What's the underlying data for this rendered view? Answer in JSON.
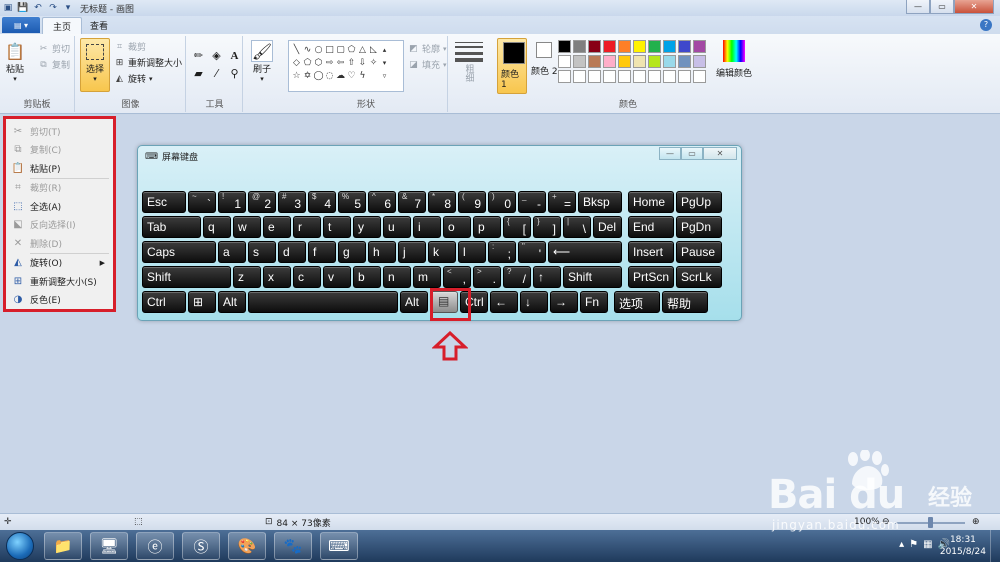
{
  "window": {
    "title": "无标题 - 画图"
  },
  "tabs": [
    {
      "label": "主页",
      "active": true
    },
    {
      "label": "查看",
      "active": false
    }
  ],
  "ribbon": {
    "clipboard": {
      "paste": "粘贴",
      "cut": "剪切",
      "copy": "复制",
      "group": "剪贴板"
    },
    "image": {
      "select": "选择",
      "crop": "裁剪",
      "resize": "重新调整大小",
      "rotate": "旋转",
      "group": "图像"
    },
    "tools": {
      "group": "工具"
    },
    "brushes": {
      "label": "刷子"
    },
    "shapes": {
      "outline": "轮廓",
      "fill": "填充",
      "group": "形状"
    },
    "size": {
      "label": "粗细"
    },
    "colors": {
      "color1": "颜色 1",
      "color2": "颜色 2",
      "edit": "编辑颜色",
      "group": "颜色",
      "palette": [
        "#000000",
        "#7f7f7f",
        "#880015",
        "#ed1c24",
        "#ff7f27",
        "#fff200",
        "#22b14c",
        "#00a2e8",
        "#3f48cc",
        "#a349a4",
        "#ffffff",
        "#c3c3c3",
        "#b97a57",
        "#ffaec9",
        "#ffc90e",
        "#efe4b0",
        "#b5e61d",
        "#99d9ea",
        "#7092be",
        "#c8bfe7",
        "#ffffff",
        "#ffffff",
        "#ffffff",
        "#ffffff",
        "#ffffff",
        "#ffffff",
        "#ffffff",
        "#ffffff",
        "#ffffff",
        "#ffffff"
      ]
    }
  },
  "context_menu": [
    {
      "label": "剪切(T)",
      "icon": "scissors-icon",
      "disabled": true
    },
    {
      "label": "复制(C)",
      "icon": "copy-icon",
      "disabled": true
    },
    {
      "label": "粘贴(P)",
      "icon": "paste-icon",
      "disabled": false
    },
    {
      "sep": true
    },
    {
      "label": "裁剪(R)",
      "icon": "crop-icon",
      "disabled": true
    },
    {
      "label": "全选(A)",
      "icon": "select-all-icon",
      "disabled": false
    },
    {
      "label": "反向选择(I)",
      "icon": "invert-selection-icon",
      "disabled": true
    },
    {
      "label": "删除(D)",
      "icon": "delete-icon",
      "disabled": true
    },
    {
      "sep": true
    },
    {
      "label": "旋转(O)",
      "icon": "rotate-icon",
      "disabled": false,
      "submenu": true
    },
    {
      "label": "重新调整大小(S)",
      "icon": "resize-icon",
      "disabled": false
    },
    {
      "label": "反色(E)",
      "icon": "invert-color-icon",
      "disabled": false
    }
  ],
  "osk": {
    "title": "屏幕键盘",
    "rows": [
      [
        {
          "l": "Esc",
          "w": 44
        },
        {
          "l": "",
          "s": "~",
          "b": "`",
          "w": 28
        },
        {
          "l": "",
          "s": "!",
          "b": "1",
          "w": 28
        },
        {
          "l": "",
          "s": "@",
          "b": "2",
          "w": 28
        },
        {
          "l": "",
          "s": "#",
          "b": "3",
          "w": 28
        },
        {
          "l": "",
          "s": "$",
          "b": "4",
          "w": 28
        },
        {
          "l": "",
          "s": "%",
          "b": "5",
          "w": 28
        },
        {
          "l": "",
          "s": "^",
          "b": "6",
          "w": 28
        },
        {
          "l": "",
          "s": "&",
          "b": "7",
          "w": 28
        },
        {
          "l": "",
          "s": "*",
          "b": "8",
          "w": 28
        },
        {
          "l": "",
          "s": "(",
          "b": "9",
          "w": 28
        },
        {
          "l": "",
          "s": ")",
          "b": "0",
          "w": 28
        },
        {
          "l": "",
          "s": "_",
          "b": "-",
          "w": 28
        },
        {
          "l": "",
          "s": "+",
          "b": "=",
          "w": 28
        },
        {
          "l": "Bksp",
          "w": 44
        },
        {
          "gap": 4
        },
        {
          "l": "Home",
          "w": 46
        },
        {
          "l": "PgUp",
          "w": 46
        }
      ],
      [
        {
          "l": "Tab",
          "w": 59
        },
        {
          "l": "q",
          "w": 28
        },
        {
          "l": "w",
          "w": 28
        },
        {
          "l": "e",
          "w": 28
        },
        {
          "l": "r",
          "w": 28
        },
        {
          "l": "t",
          "w": 28
        },
        {
          "l": "y",
          "w": 28
        },
        {
          "l": "u",
          "w": 28
        },
        {
          "l": "i",
          "w": 28
        },
        {
          "l": "o",
          "w": 28
        },
        {
          "l": "p",
          "w": 28
        },
        {
          "l": "",
          "s": "{",
          "b": "[",
          "w": 28
        },
        {
          "l": "",
          "s": "}",
          "b": "]",
          "w": 28
        },
        {
          "l": "",
          "s": "|",
          "b": "\\",
          "w": 28
        },
        {
          "l": "Del",
          "w": 29
        },
        {
          "gap": 4
        },
        {
          "l": "End",
          "w": 46
        },
        {
          "l": "PgDn",
          "w": 46
        }
      ],
      [
        {
          "l": "Caps",
          "w": 74
        },
        {
          "l": "a",
          "w": 28
        },
        {
          "l": "s",
          "w": 28
        },
        {
          "l": "d",
          "w": 28
        },
        {
          "l": "f",
          "w": 28
        },
        {
          "l": "g",
          "w": 28
        },
        {
          "l": "h",
          "w": 28
        },
        {
          "l": "j",
          "w": 28
        },
        {
          "l": "k",
          "w": 28
        },
        {
          "l": "l",
          "w": 28
        },
        {
          "l": "",
          "s": ":",
          "b": ";",
          "w": 28
        },
        {
          "l": "",
          "s": "\"",
          "b": "'",
          "w": 28
        },
        {
          "l": "⟵",
          "w": 74
        },
        {
          "gap": 4
        },
        {
          "l": "Insert",
          "w": 46
        },
        {
          "l": "Pause",
          "w": 46
        }
      ],
      [
        {
          "l": "Shift",
          "w": 89
        },
        {
          "l": "z",
          "w": 28
        },
        {
          "l": "x",
          "w": 28
        },
        {
          "l": "c",
          "w": 28
        },
        {
          "l": "v",
          "w": 28
        },
        {
          "l": "b",
          "w": 28
        },
        {
          "l": "n",
          "w": 28
        },
        {
          "l": "m",
          "w": 28
        },
        {
          "l": "",
          "s": "<",
          "b": ",",
          "w": 28
        },
        {
          "l": "",
          "s": ">",
          "b": ".",
          "w": 28
        },
        {
          "l": "",
          "s": "?",
          "b": "/",
          "w": 28
        },
        {
          "l": "↑",
          "w": 28
        },
        {
          "l": "Shift",
          "w": 59
        },
        {
          "gap": 4
        },
        {
          "l": "PrtScn",
          "w": 46
        },
        {
          "l": "ScrLk",
          "w": 46
        }
      ],
      [
        {
          "l": "Ctrl",
          "w": 44
        },
        {
          "l": "⊞",
          "w": 28
        },
        {
          "l": "Alt",
          "w": 28
        },
        {
          "l": "",
          "w": 150
        },
        {
          "l": "Alt",
          "w": 28
        },
        {
          "l": "▤",
          "w": 28,
          "hl": true
        },
        {
          "l": "Ctrl",
          "w": 28
        },
        {
          "l": "←",
          "w": 28
        },
        {
          "l": "↓",
          "w": 28
        },
        {
          "l": "→",
          "w": 28
        },
        {
          "l": "Fn",
          "w": 28
        },
        {
          "gap": 4
        },
        {
          "l": "选项",
          "w": 46
        },
        {
          "l": "帮助",
          "w": 46
        }
      ]
    ]
  },
  "status": {
    "size": "84 × 73像素",
    "zoom": "100%"
  },
  "taskbar": {
    "time": "18:31",
    "date": "2015/8/24"
  },
  "watermark": {
    "brand": "Bai du",
    "cn": "经验",
    "url": "jingyan.baidu.com"
  }
}
